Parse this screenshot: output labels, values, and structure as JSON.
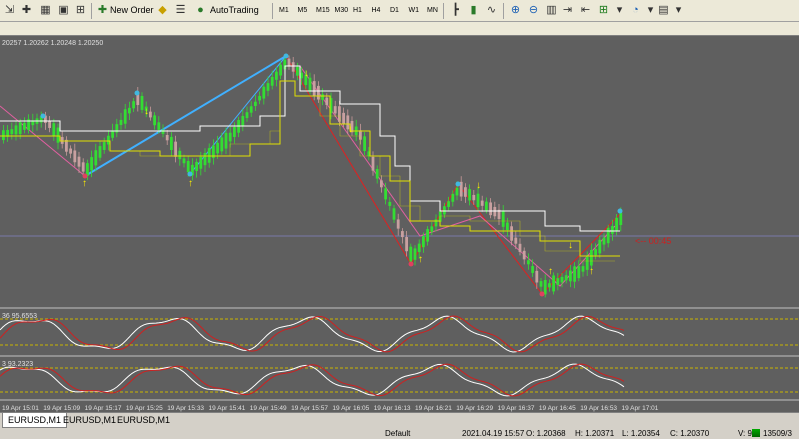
{
  "toolbar": {
    "new_order": "New Order",
    "auto_trading": "AutoTrading",
    "timeframes": [
      "M1",
      "M5",
      "M15",
      "M30",
      "H1",
      "H4",
      "D1",
      "W1",
      "MN"
    ],
    "colors": {
      "buy": "#00cc00",
      "sell": "#cc0000"
    }
  },
  "chart": {
    "main_label": "20257 1.20262 1.20248 1.20250",
    "countdown": "<-- 00:45",
    "ind1_label": "36 95.6553",
    "ind2_label": "3 93.2323",
    "time_labels": [
      "19 Apr 15:01",
      "19 Apr 15:09",
      "19 Apr 15:17",
      "19 Apr 15:25",
      "19 Apr 15:33",
      "19 Apr 15:41",
      "19 Apr 15:49",
      "19 Apr 15:57",
      "19 Apr 16:05",
      "19 Apr 16:13",
      "19 Apr 16:21",
      "19 Apr 16:29",
      "19 Apr 16:37",
      "19 Apr 16:45",
      "19 Apr 16:53",
      "19 Apr 17:01"
    ]
  },
  "tabs": [
    "EURUSD,M1",
    "EURUSD,M1",
    "EURUSD,M1"
  ],
  "status": {
    "profile": "Default",
    "datetime": "2021.04.19 15:57",
    "open": "O: 1.20368",
    "high": "H: 1.20371",
    "low": "L: 1.20354",
    "close": "C: 1.20370",
    "volume": "V: 92",
    "traffic": "13509/3"
  }
}
